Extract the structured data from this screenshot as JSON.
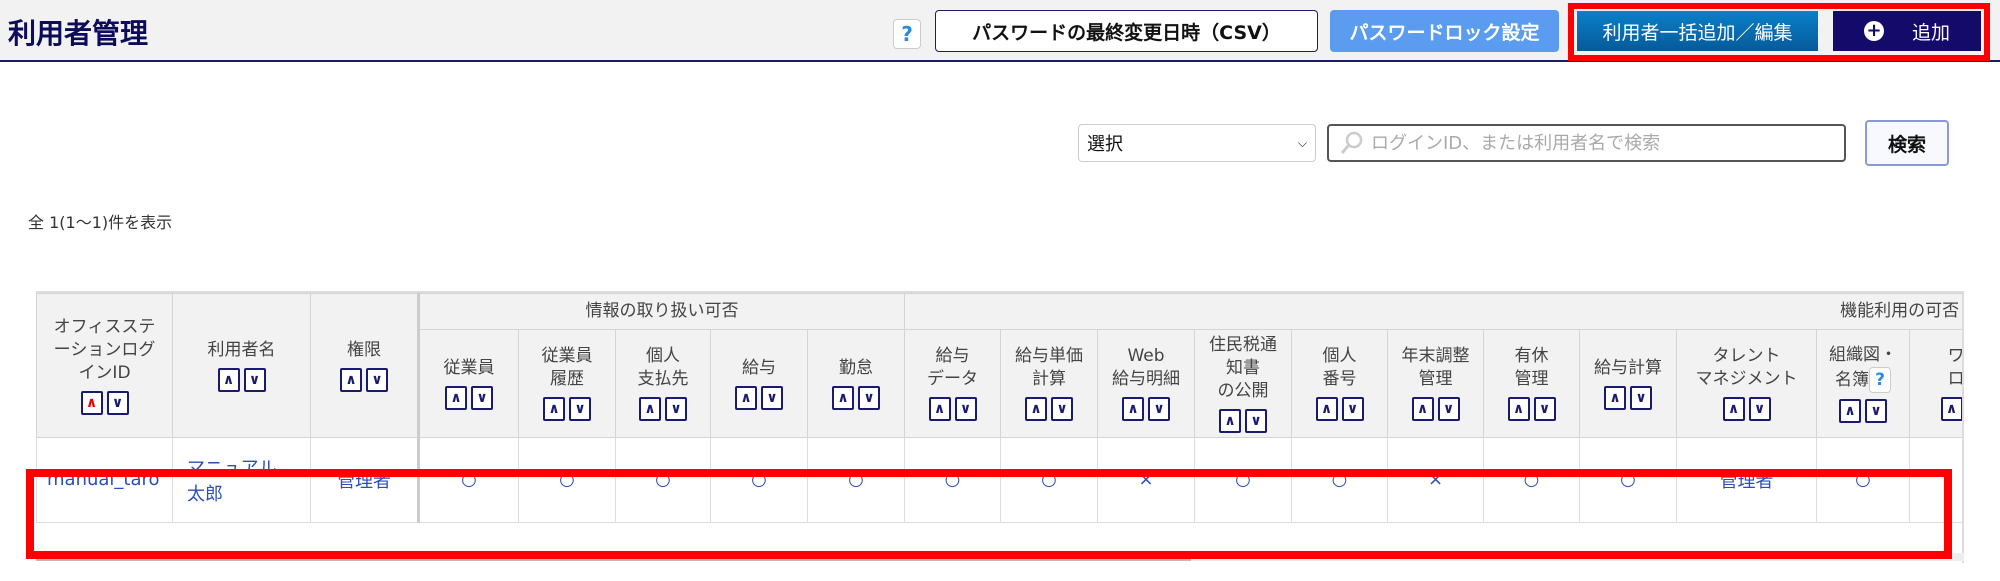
{
  "header": {
    "title": "利用者管理",
    "help": "?",
    "csv_button": "パスワードの最終変更日時（CSV）",
    "lock_button": "パスワードロック設定",
    "bulk_button": "利用者一括追加／編集",
    "add_button": "追加",
    "add_icon": "plus-circle-icon"
  },
  "search": {
    "select_value": "選択",
    "placeholder": "ログインID、または利用者名で検索",
    "button": "検索"
  },
  "count_text": "全 1(1～1)件を表示",
  "table": {
    "group1": "情報の取り扱い可否",
    "group2": "機能利用の可否",
    "columns": [
      {
        "label": "オフィスステ\nーションログ\nインID",
        "w": 136
      },
      {
        "label": "利用者名",
        "w": 138
      },
      {
        "label": "権限",
        "w": 108
      },
      {
        "label": "従業員",
        "w": 100
      },
      {
        "label": "従業員\n履歴",
        "w": 97
      },
      {
        "label": "個人\n支払先",
        "w": 95
      },
      {
        "label": "給与",
        "w": 97
      },
      {
        "label": "勤怠",
        "w": 97
      },
      {
        "label": "給与\nデータ",
        "w": 96
      },
      {
        "label": "給与単価\n計算",
        "w": 97
      },
      {
        "label": "Web\n給与明細",
        "w": 97
      },
      {
        "label": "住民税通\n知書\nの公開",
        "w": 97
      },
      {
        "label": "個人\n番号",
        "w": 96
      },
      {
        "label": "年末調整\n管理",
        "w": 96
      },
      {
        "label": "有休\n管理",
        "w": 96
      },
      {
        "label": "給与計算",
        "w": 97
      },
      {
        "label": "タレント\nマネジメント",
        "w": 140
      },
      {
        "label": "組織図・\n名簿",
        "w": 93,
        "help": "?"
      },
      {
        "label": "ワー\nロー",
        "w": 110
      }
    ],
    "rows": [
      [
        "manual_taro",
        "マニュアル\n太郎",
        "管理者",
        "○",
        "○",
        "○",
        "○",
        "○",
        "○",
        "○",
        "×",
        "○",
        "○",
        "×",
        "○",
        "○",
        "管理者",
        "○",
        ""
      ]
    ]
  }
}
